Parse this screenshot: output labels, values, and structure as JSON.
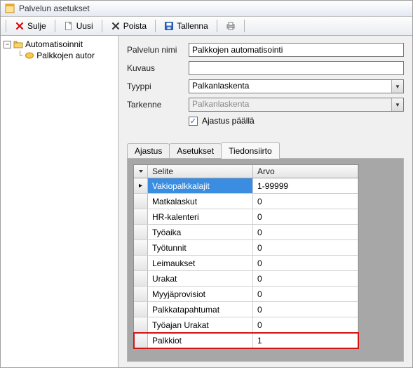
{
  "window_title": "Palvelun asetukset",
  "toolbar": {
    "close": "Sulje",
    "new": "Uusi",
    "delete": "Poista",
    "save": "Tallenna"
  },
  "tree": {
    "root": "Automatisoinnit",
    "child": "Palkkojen autor"
  },
  "form": {
    "labels": {
      "name": "Palvelun nimi",
      "description": "Kuvaus",
      "type": "Tyyppi",
      "subtype": "Tarkenne",
      "scheduling": "Ajastus päällä"
    },
    "values": {
      "name": "Palkkojen automatisointi",
      "description": "",
      "type": "Palkanlaskenta",
      "subtype": "Palkanlaskenta",
      "scheduling_checked": true
    }
  },
  "tabs": {
    "t0": "Ajastus",
    "t1": "Asetukset",
    "t2": "Tiedonsiirto",
    "active_index": 2
  },
  "grid": {
    "headers": {
      "selite": "Selite",
      "arvo": "Arvo"
    },
    "rows": [
      {
        "selite": "Vakiopalkkalajit",
        "arvo": "1-99999",
        "selected": true
      },
      {
        "selite": "Matkalaskut",
        "arvo": "0"
      },
      {
        "selite": "HR-kalenteri",
        "arvo": "0"
      },
      {
        "selite": "Työaika",
        "arvo": "0"
      },
      {
        "selite": "Työtunnit",
        "arvo": "0"
      },
      {
        "selite": "Leimaukset",
        "arvo": "0"
      },
      {
        "selite": "Urakat",
        "arvo": "0"
      },
      {
        "selite": "Myyjäprovisiot",
        "arvo": "0"
      },
      {
        "selite": "Palkkatapahtumat",
        "arvo": "0"
      },
      {
        "selite": "Työajan Urakat",
        "arvo": "0"
      },
      {
        "selite": "Palkkiot",
        "arvo": "1",
        "highlight": true
      }
    ]
  }
}
